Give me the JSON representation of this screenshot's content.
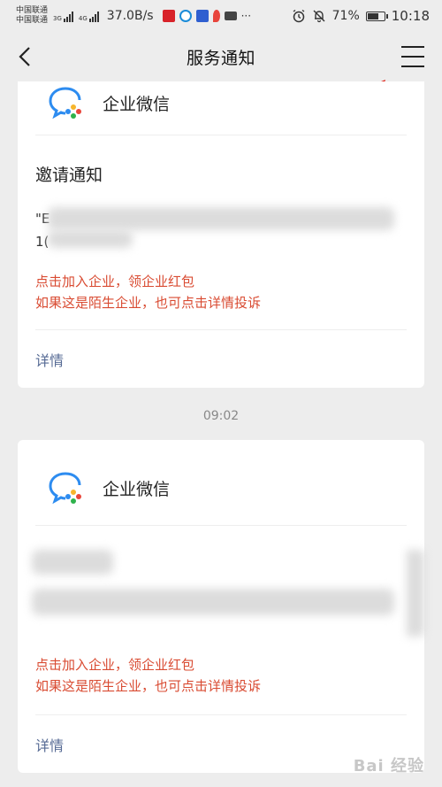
{
  "status_bar": {
    "carrier1": "中国联通",
    "carrier2": "中国联通",
    "net1": "3G",
    "net2": "4G",
    "speed": "37.0B/s",
    "battery_percent": "71%",
    "battery_level": 0.71,
    "time": "10:18",
    "more_glyph": "···"
  },
  "header": {
    "title": "服务通知",
    "back_icon": "chevron-left-icon",
    "menu_icon": "menu-icon"
  },
  "cards": [
    {
      "app_name": "企业微信",
      "section_title": "邀请通知",
      "quote_line1_visible": "\"E",
      "quote_line2_visible": "1(",
      "promo_line1": "点击加入企业，领企业红包",
      "promo_line2": "如果这是陌生企业，也可点击详情投诉",
      "detail_label": "详情"
    },
    {
      "app_name": "企业微信",
      "section_title": "",
      "promo_line1": "点击加入企业，领企业红包",
      "promo_line2": "如果这是陌生企业，也可点击详情投诉",
      "detail_label": "详情"
    }
  ],
  "timestamp": "09:02",
  "watermark": "Bai 经验",
  "colors": {
    "background": "#ededed",
    "promo_red": "#d94b32",
    "link_blue": "#576b95",
    "arrow_red": "#e0261c"
  }
}
